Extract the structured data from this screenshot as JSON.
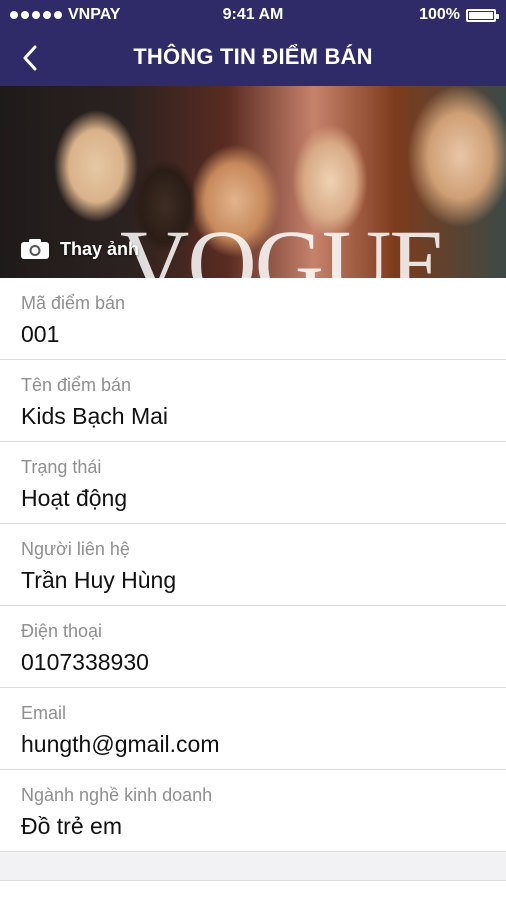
{
  "status_bar": {
    "carrier": "VNPAY",
    "time": "9:41 AM",
    "battery": "100%"
  },
  "header": {
    "title": "THÔNG TIN ĐIỂM BÁN",
    "back_icon": "chevron-left-icon"
  },
  "banner": {
    "change_photo_label": "Thay ảnh",
    "camera_icon": "camera-icon",
    "logo_text": "VOGUE"
  },
  "fields": [
    {
      "label": "Mã điểm bán",
      "value": "001"
    },
    {
      "label": "Tên điểm bán",
      "value": "Kids Bạch Mai"
    },
    {
      "label": "Trạng thái",
      "value": "Hoạt động"
    },
    {
      "label": "Người liên hệ",
      "value": "Trần Huy Hùng"
    },
    {
      "label": "Điện thoại",
      "value": "0107338930"
    },
    {
      "label": "Email",
      "value": "hungth@gmail.com"
    },
    {
      "label": "Ngành nghề kinh doanh",
      "value": "Đồ trẻ em"
    }
  ],
  "colors": {
    "header_bg": "#2e2b68",
    "label_text": "#8f8f8f",
    "value_text": "#111111"
  }
}
